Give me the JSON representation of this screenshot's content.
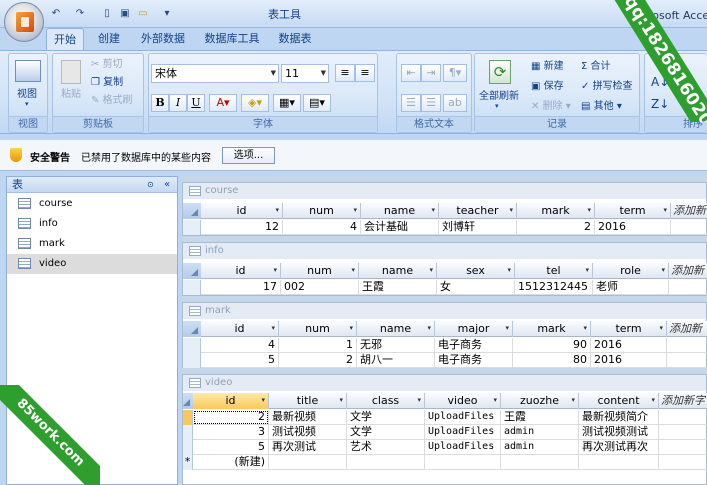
{
  "window": {
    "context_tab_title": "表工具",
    "app_title": "rosoft Acce",
    "qat_icons": [
      "undo-icon",
      "redo-icon",
      "new-icon",
      "save-icon",
      "open-icon"
    ]
  },
  "tabs": [
    "开始",
    "创建",
    "外部数据",
    "数据库工具",
    "数据表"
  ],
  "ribbon": {
    "view_group": {
      "button": "视图",
      "label": "视图"
    },
    "clipboard_group": {
      "paste": "粘贴",
      "cut": "剪切",
      "copy": "复制",
      "format_painter": "格式刷",
      "label": "剪贴板"
    },
    "font_group": {
      "font_name": "宋体",
      "font_size": "11",
      "bold": "B",
      "italic": "I",
      "underline": "U",
      "label": "字体"
    },
    "richtext_group": {
      "label": "格式文本"
    },
    "records_group": {
      "refresh_all": "全部刷新",
      "new": "新建",
      "save": "保存",
      "delete": "删除",
      "totals": "合计",
      "spelling": "拼写检查",
      "more": "其他",
      "label": "记录"
    },
    "sort_group": {
      "label": "排序"
    }
  },
  "security": {
    "title": "安全警告",
    "message": "已禁用了数据库中的某些内容",
    "options_button": "选项..."
  },
  "nav_pane": {
    "header": "表",
    "items": [
      "course",
      "info",
      "mark",
      "video"
    ],
    "selected": "video"
  },
  "tables": {
    "course": {
      "title": "course",
      "columns": [
        "id",
        "num",
        "name",
        "teacher",
        "mark",
        "term",
        "添加新"
      ],
      "rows": [
        [
          "12",
          "4",
          "会计基础",
          "刘博轩",
          "2",
          "2016"
        ]
      ]
    },
    "info": {
      "title": "info",
      "columns": [
        "id",
        "num",
        "name",
        "sex",
        "tel",
        "role",
        "添加新"
      ],
      "rows": [
        [
          "17",
          "002",
          "王霞",
          "女",
          "1512312445",
          "老师"
        ]
      ]
    },
    "mark": {
      "title": "mark",
      "columns": [
        "id",
        "num",
        "name",
        "major",
        "mark",
        "term",
        "添加新"
      ],
      "rows": [
        [
          "4",
          "1",
          "无邪",
          "电子商务",
          "90",
          "2016"
        ],
        [
          "5",
          "2",
          "胡八一",
          "电子商务",
          "80",
          "2016"
        ]
      ]
    },
    "video": {
      "title": "video",
      "columns": [
        "id",
        "title",
        "class",
        "video",
        "zuozhe",
        "content",
        "添加新字"
      ],
      "rows": [
        [
          "2",
          "最新视频",
          "文学",
          "UploadFiles",
          "王霞",
          "最新视频简介"
        ],
        [
          "3",
          "测试视频",
          "文学",
          "UploadFiles",
          "admin",
          "测试视频测试"
        ],
        [
          "5",
          "再次测试",
          "艺术",
          "UploadFiles",
          "admin",
          "再次测试再次"
        ]
      ],
      "new_row_label": "(新建)",
      "new_row_marker": "*"
    }
  },
  "watermarks": {
    "top_right": "qq:1826816020",
    "bottom_left": "85work.com"
  },
  "colors": {
    "ribbon_bg": "#d2e3f7",
    "accent_orange": "#f7a43a",
    "watermark_green": "#2e9e2e"
  }
}
